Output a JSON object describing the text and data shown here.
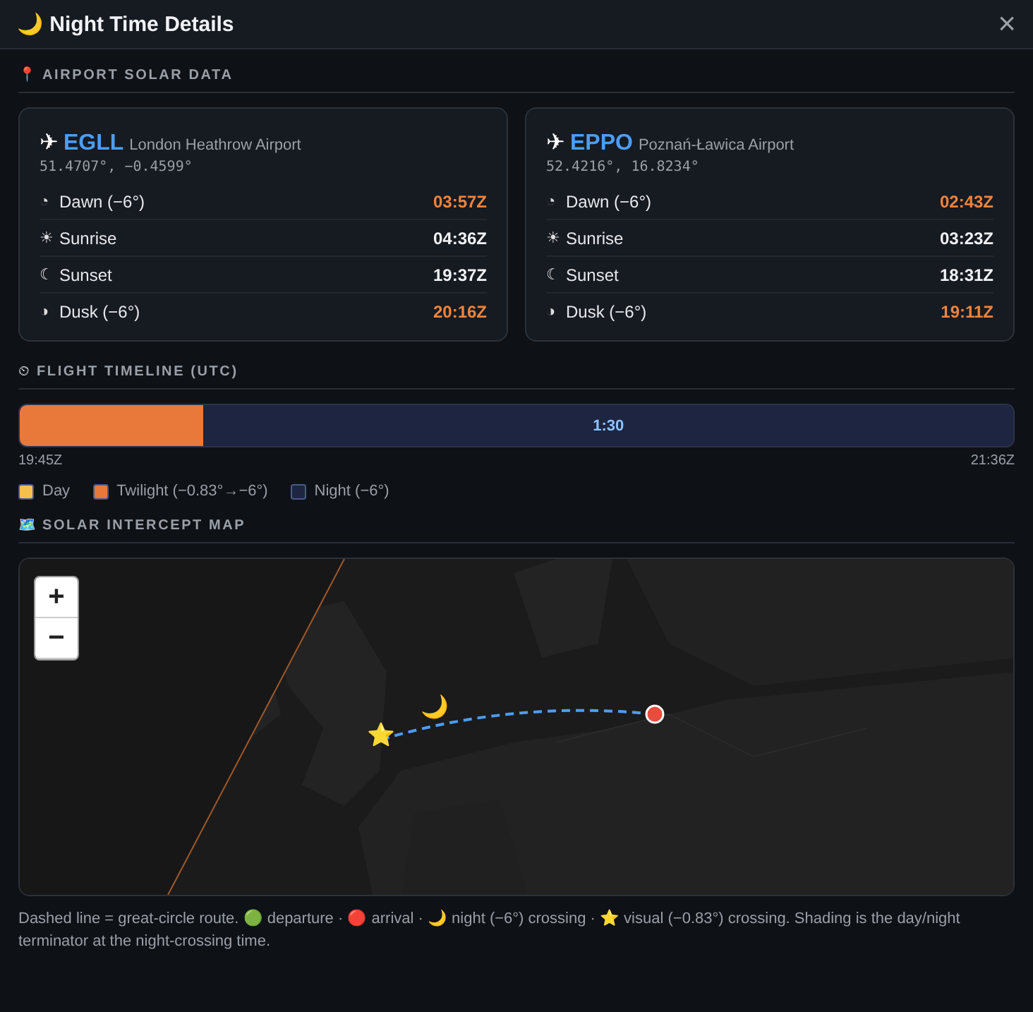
{
  "dialog": {
    "title_icon": "🌙",
    "title": "Night Time Details",
    "close": "×"
  },
  "airport_section": {
    "icon": "📍",
    "title": "AIRPORT SOLAR DATA"
  },
  "airports": [
    {
      "icon": "✈",
      "code": "EGLL",
      "name": "London Heathrow Airport",
      "coords": "51.4707°, −0.4599°",
      "events": [
        {
          "icon": "◔",
          "label": "Dawn (−6°)",
          "time": "03:57Z",
          "kind": "twilight"
        },
        {
          "icon": "☀",
          "label": "Sunrise",
          "time": "04:36Z",
          "kind": "sun"
        },
        {
          "icon": "☾",
          "label": "Sunset",
          "time": "19:37Z",
          "kind": "sun"
        },
        {
          "icon": "◑",
          "label": "Dusk (−6°)",
          "time": "20:16Z",
          "kind": "twilight"
        }
      ]
    },
    {
      "icon": "✈",
      "code": "EPPO",
      "name": "Poznań-Ławica Airport",
      "coords": "52.4216°, 16.8234°",
      "events": [
        {
          "icon": "◔",
          "label": "Dawn (−6°)",
          "time": "02:43Z",
          "kind": "twilight"
        },
        {
          "icon": "☀",
          "label": "Sunrise",
          "time": "03:23Z",
          "kind": "sun"
        },
        {
          "icon": "☾",
          "label": "Sunset",
          "time": "18:31Z",
          "kind": "sun"
        },
        {
          "icon": "◑",
          "label": "Dusk (−6°)",
          "time": "19:11Z",
          "kind": "twilight"
        }
      ]
    }
  ],
  "timeline_section": {
    "icon": "⏲",
    "title": "FLIGHT TIMELINE (UTC)"
  },
  "timeline": {
    "segments": [
      {
        "kind": "twilight",
        "level": 0.185
      },
      {
        "kind": "night",
        "level": 0.815,
        "label": "1:30"
      }
    ],
    "start": "19:45Z",
    "end": "21:36Z"
  },
  "legend": [
    {
      "label": "Day",
      "color": "#f6c04e"
    },
    {
      "label": "Twilight (−0.83°→−6°)",
      "color": "#e8793b"
    },
    {
      "label": "Night (−6°)",
      "color": "#1e2540"
    }
  ],
  "map_section": {
    "icon": "🗺️",
    "title": "SOLAR INTERCEPT MAP"
  },
  "map": {
    "zoom_in": "+",
    "zoom_out": "−",
    "visual_marker": "⭐",
    "night_marker": "🌙"
  },
  "footnote": "Dashed line = great-circle route. 🟢 departure · 🔴 arrival · 🌙 night (−6°) crossing · ⭐ visual (−0.83°) crossing. Shading is the day/night terminator at the night-crossing time."
}
